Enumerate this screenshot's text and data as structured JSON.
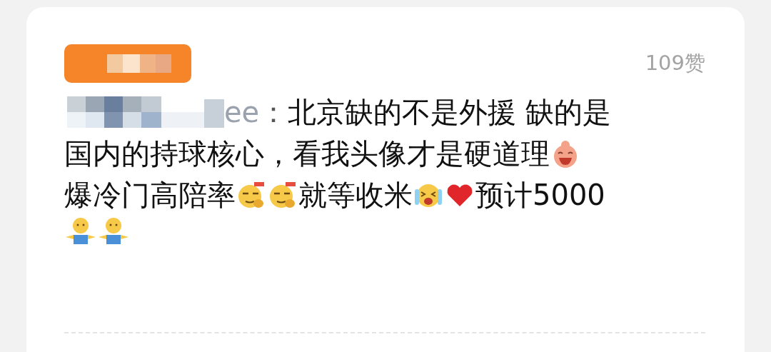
{
  "comment": {
    "likes": "109赞",
    "author": "ee",
    "separator": "：",
    "lines": [
      [
        {
          "kind": "text",
          "text": "北京缺的不是外援 缺的是"
        }
      ],
      [
        {
          "kind": "text",
          "text": "国内的持球核心，看我头像才是硬道理"
        },
        {
          "kind": "grin"
        }
      ],
      [
        {
          "kind": "text",
          "text": "爆冷门高陪率"
        },
        {
          "kind": "smirk"
        },
        {
          "kind": "smirk"
        },
        {
          "kind": "text",
          "text": "就等收米"
        },
        {
          "kind": "cry"
        },
        {
          "kind": "heart"
        },
        {
          "kind": "text",
          "text": "预计5000"
        }
      ],
      [
        {
          "kind": "hug"
        },
        {
          "kind": "hug"
        }
      ]
    ]
  }
}
